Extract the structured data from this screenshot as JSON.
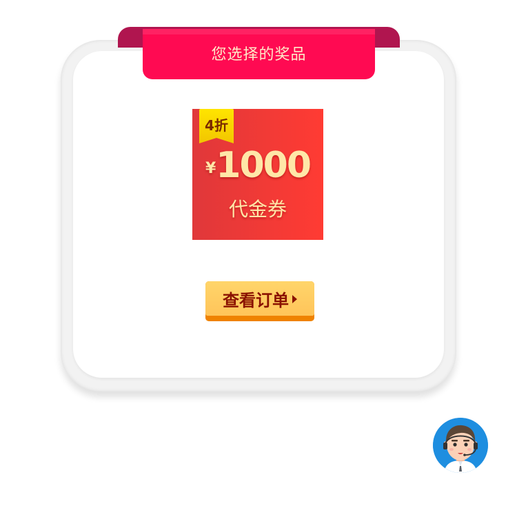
{
  "banner": {
    "title": "您选择的奖品"
  },
  "coupon": {
    "discount_tag": "4折",
    "currency_symbol": "¥",
    "amount": "1000",
    "label": "代金券"
  },
  "actions": {
    "view_order_label": "查看订单",
    "view_order_icon": "caret-right-icon"
  },
  "support": {
    "avatar_icon": "customer-service-avatar-icon"
  },
  "colors": {
    "ribbon": "#ff0a52",
    "ribbon_back": "#b0154f",
    "coupon_red": "#ff3b33",
    "coupon_text": "#ffe7a8",
    "tag_yellow": "#ffe500",
    "button_face": "#ffd56a",
    "button_edge": "#ef8200",
    "button_text": "#8a1200",
    "avatar_bg": "#1e8ee0"
  }
}
